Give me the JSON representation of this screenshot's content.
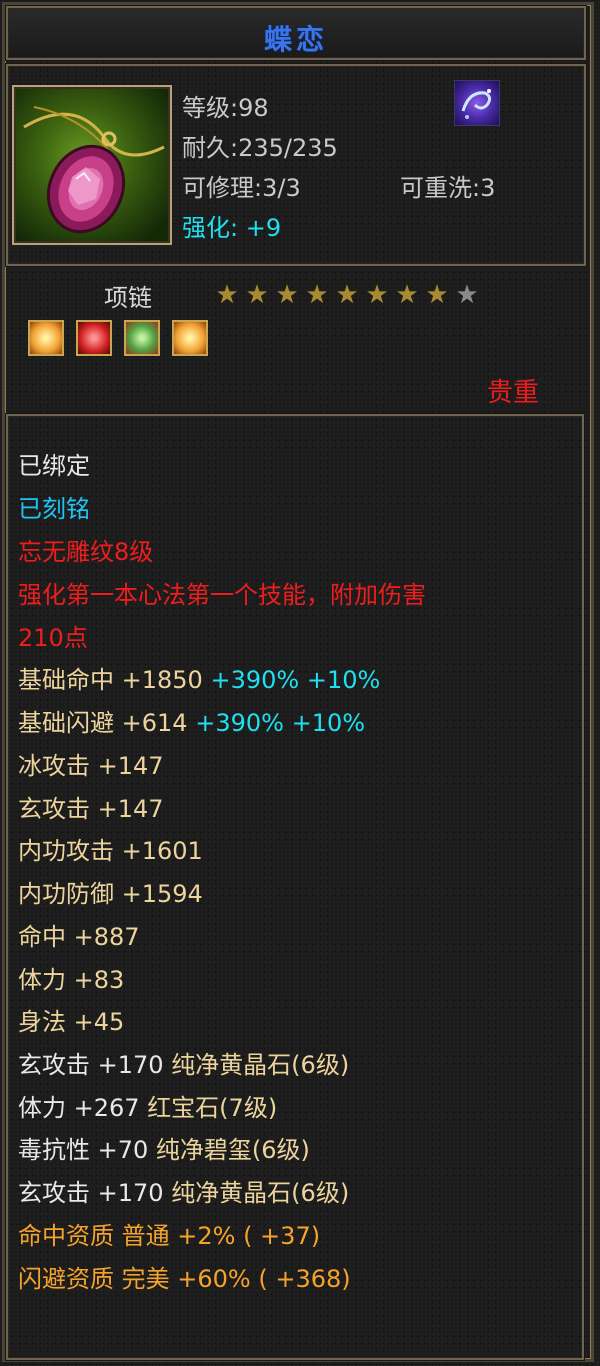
{
  "item": {
    "name": "蝶恋",
    "level_label": "等级:98",
    "durability_label": "耐久:235/235",
    "repair_label": "可修理:3/3",
    "rewash_label": "可重洗:3",
    "enhance_label": "强化:",
    "enhance_value": "+9",
    "slot": "项链",
    "stars_total": 9,
    "stars_filled": 8,
    "quality": "贵重",
    "icon": "pink-gem-necklace-icon",
    "badge_icon": "purple-swirl-gem-icon",
    "sockets": [
      {
        "icon": "yellow-gem-socket-icon",
        "color": "#f2a030"
      },
      {
        "icon": "red-gem-socket-icon",
        "color": "#d02020"
      },
      {
        "icon": "green-gem-socket-icon",
        "color": "#50a040"
      },
      {
        "icon": "yellow-gem-socket-icon",
        "color": "#f2a030"
      }
    ]
  },
  "status": {
    "bound": "已绑定",
    "engraved": "已刻铭",
    "carving": "忘无雕纹8级",
    "carving_desc_1": "强化第一本心法第一个技能，附加伤害",
    "carving_desc_2": "210点"
  },
  "base_stats": [
    {
      "label": "基础命中",
      "value": "+1850",
      "pct1": "+390%",
      "pct2": "+10%"
    },
    {
      "label": "基础闪避",
      "value": "+614",
      "pct1": "+390%",
      "pct2": "+10%"
    }
  ],
  "attributes": [
    {
      "text": "冰攻击 +147"
    },
    {
      "text": "玄攻击 +147"
    },
    {
      "text": "内功攻击 +1601"
    },
    {
      "text": "内功防御 +1594"
    },
    {
      "text": "命中 +887"
    },
    {
      "text": "体力 +83"
    },
    {
      "text": "身法 +45"
    }
  ],
  "gem_attributes": [
    {
      "text": "玄攻击 +170 纯净黄晶石(6级)"
    },
    {
      "text": "体力 +267 红宝石(7级)"
    },
    {
      "text": "毒抗性 +70 纯净碧玺(6级)"
    },
    {
      "text": "玄攻击 +170 纯净黄晶石(6级)"
    }
  ],
  "aptitudes": [
    {
      "text": "命中资质  普通 +2% ( +37)"
    },
    {
      "text": "闪避资质  完美 +60% ( +368)"
    }
  ],
  "colors": {
    "title": "#3a74e8",
    "enhance": "#1fe0f0",
    "quality": "#ee1c1c",
    "bound": "#e8e8e8",
    "engraved": "#1fc6f5",
    "carving": "#f01d1d",
    "base_label": "#ecd49c",
    "base_pct": "#1fe0f0",
    "attribute": "#ecd49c",
    "aptitude": "#f5a32a"
  }
}
